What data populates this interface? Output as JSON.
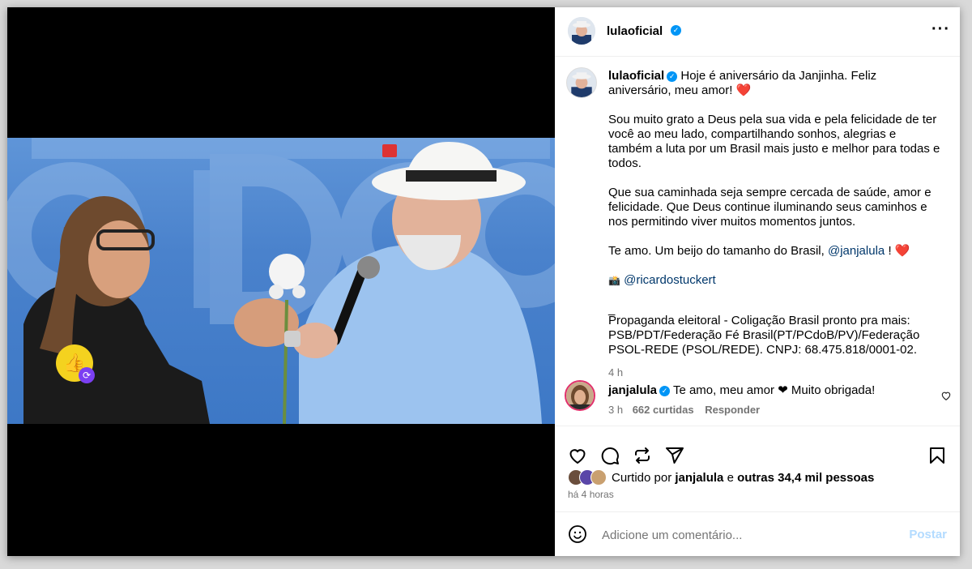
{
  "post": {
    "header": {
      "username": "lulaoficial",
      "more_icon": "more-horizontal-icon"
    },
    "caption": {
      "username": "lulaoficial",
      "line1": "Hoje é aniversário da Janjinha. Feliz aniversário, meu amor! ❤️",
      "p2": "Sou muito grato a Deus pela sua vida e pela felicidade de ter você ao meu lado, compartilhando sonhos, alegrias e também a luta por um Brasil mais justo e melhor para todas e todos.",
      "p3": "Que sua caminhada seja sempre cercada de saúde, amor e felicidade. Que Deus continue iluminando seus caminhos e nos permitindo viver muitos momentos juntos.",
      "p4_text": "Te amo. Um beijo do tamanho do Brasil,",
      "p4_mention": "@janjalula",
      "p4_end": "! ❤️",
      "photo_credit_icon": "camera-icon",
      "photo_credit": "@ricardostuckert",
      "dash": "_",
      "disclaimer": "Propaganda eleitoral - Coligação Brasil pronto pra mais: PSB/PDT/Federação Fé Brasil(PT/PCdoB/PV)/Federação PSOL-REDE (PSOL/REDE). CNPJ: 68.475.818/0001-02.",
      "time": "4 h"
    },
    "comment": {
      "username": "janjalula",
      "text": "Te amo, meu amor ❤ Muito obrigada!",
      "time": "3 h",
      "likes": "662 curtidas",
      "reply": "Responder"
    },
    "likes": {
      "prefix": "Curtido por",
      "user": "janjalula",
      "middle": "e",
      "others": "outras 34,4 mil pessoas",
      "time": "há 4 horas"
    },
    "add_comment": {
      "placeholder": "Adicione um comentário...",
      "post_label": "Postar"
    }
  }
}
